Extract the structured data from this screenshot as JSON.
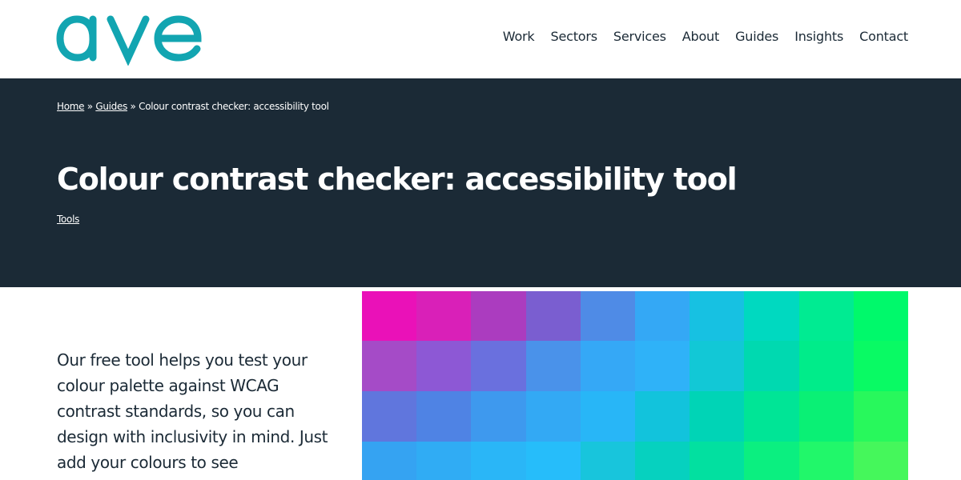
{
  "brand": {
    "logo_text": "ave",
    "logo_color": "#12a5b1"
  },
  "nav": {
    "items": [
      "Work",
      "Sectors",
      "Services",
      "About",
      "Guides",
      "Insights",
      "Contact"
    ]
  },
  "breadcrumb": {
    "home": "Home",
    "sep1": " » ",
    "guides": "Guides",
    "sep2": " » ",
    "current": "Colour contrast checker: accessibility tool"
  },
  "hero": {
    "title": "Colour contrast checker: accessibility tool",
    "tag": "Tools",
    "background": "#1b2a36"
  },
  "intro": {
    "text": "Our free tool helps you test your colour palette against WCAG contrast standards, so you can design with inclusivity in mind. Just add your colours to see"
  },
  "mosaic": {
    "rows": [
      [
        "#ea11b8",
        "#d920b8",
        "#ab3cbf",
        "#7a5ed0",
        "#4f8be6",
        "#34a8f5",
        "#17c1e2",
        "#00d9c0",
        "#00eb92",
        "#00f96b"
      ],
      [
        "#a54bc7",
        "#8d58d5",
        "#6a70de",
        "#4a92ea",
        "#35a8f6",
        "#2fb2f8",
        "#12c8d6",
        "#00d9b0",
        "#00ec8a",
        "#09fa64"
      ],
      [
        "#6076dd",
        "#4f83e4",
        "#3e99ee",
        "#33a9f4",
        "#28b6f7",
        "#12c3dc",
        "#00d4b6",
        "#00e596",
        "#0af075",
        "#28f85c"
      ],
      [
        "#35a3f2",
        "#30acf4",
        "#2ab6f7",
        "#26bdfa",
        "#18c5dc",
        "#06d1bf",
        "#02e0a0",
        "#0bef80",
        "#21f76a",
        "#45f75b"
      ]
    ]
  }
}
